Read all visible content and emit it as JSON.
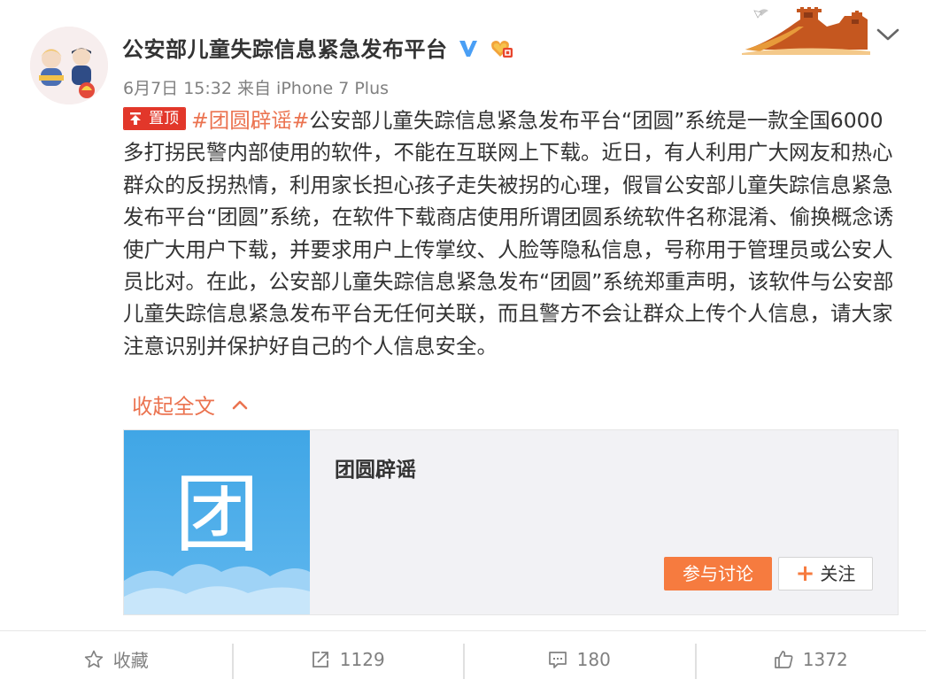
{
  "author": {
    "screen_name": "公安部儿童失踪信息紧急发布平台",
    "verified_icon": "verified-v-icon",
    "member_icon": "vip-member-icon"
  },
  "meta": {
    "time_source": "6月7日 15:32 来自 iPhone 7 Plus"
  },
  "post": {
    "pin_label": "置顶",
    "topic": "#团圆辟谣#",
    "body": "公安部儿童失踪信息紧急发布平台“团圆”系统是一款全国6000多打拐民警内部使用的软件，不能在互联网上下载。近日，有人利用广大网友和热心群众的反拐热情，利用家长担心孩子走失被拐的心理，假冒公安部儿童失踪信息紧急发布平台“团圆”系统，在软件下载商店使用所谓团圆系统软件名称混淆、偷换概念诱使广大用户下载，并要求用户上传掌纹、人脸等隐私信息，号称用于管理员或公安人员比对。在此，公安部儿童失踪信息紧急发布“团圆”系统郑重声明，该软件与公安部儿童失踪信息紧急发布平台无任何关联，而且警方不会让群众上传个人信息，请大家注意识别并保护好自己的个人信息安全。",
    "collapse_label": "收起全文"
  },
  "topic_card": {
    "thumb_char": "团",
    "title": "团圆辟谣",
    "join_label": "参与讨论",
    "follow_label": "关注"
  },
  "toolbar": {
    "favorite_label": "收藏",
    "repost_count": "1129",
    "comment_count": "180",
    "like_count": "1372"
  },
  "colors": {
    "accent": "#eb7350",
    "pin_red": "#e2372a",
    "verified_blue": "#4a9ff5",
    "card_blue": "#40a6e6"
  }
}
